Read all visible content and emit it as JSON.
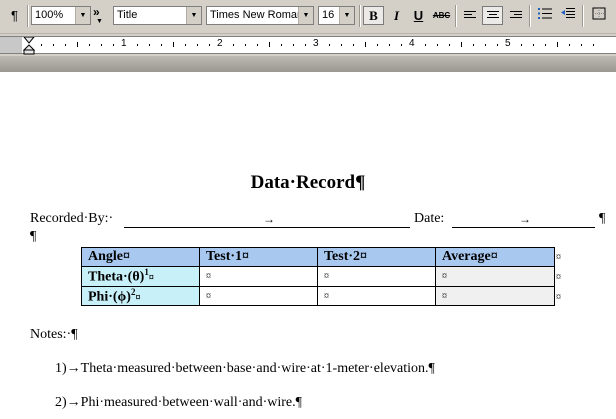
{
  "toolbar": {
    "pilcrow_button": "¶",
    "zoom": "100%",
    "overflow_chevron": "»",
    "style": "Title",
    "font": "Times New Roman",
    "size": "16",
    "bold_label": "B",
    "italic_label": "I",
    "underline_label": "U",
    "strikethrough_label": "ABC"
  },
  "ruler": {
    "numbers": [
      "1",
      "2",
      "3",
      "4",
      "5"
    ]
  },
  "document": {
    "title": "Data·Record¶",
    "recorded_by_label": "Recorded·By:·",
    "date_label": "Date:",
    "tab_arrow": "→",
    "pilcrow": "¶",
    "empty_para": "¶",
    "table": {
      "headers": [
        "Angle¤",
        "Test·1¤",
        "Test·2¤",
        "Average¤"
      ],
      "rows": [
        {
          "label": "Theta·(θ)",
          "sup": "1",
          "cells": [
            "¤",
            "¤",
            "¤"
          ]
        },
        {
          "label": "Phi·(ϕ)",
          "sup": "2",
          "cells": [
            "¤",
            "¤",
            "¤"
          ]
        }
      ],
      "row_end": "¤",
      "cell_end": "¤"
    },
    "notes_label": "Notes:·¶",
    "notes": [
      {
        "num": "1)→",
        "text": "Theta·measured·between·base·and·wire·at·1-meter·elevation.¶"
      },
      {
        "num": "2)→",
        "text": "Phi·measured·between·wall·and·wire.¶"
      }
    ]
  }
}
